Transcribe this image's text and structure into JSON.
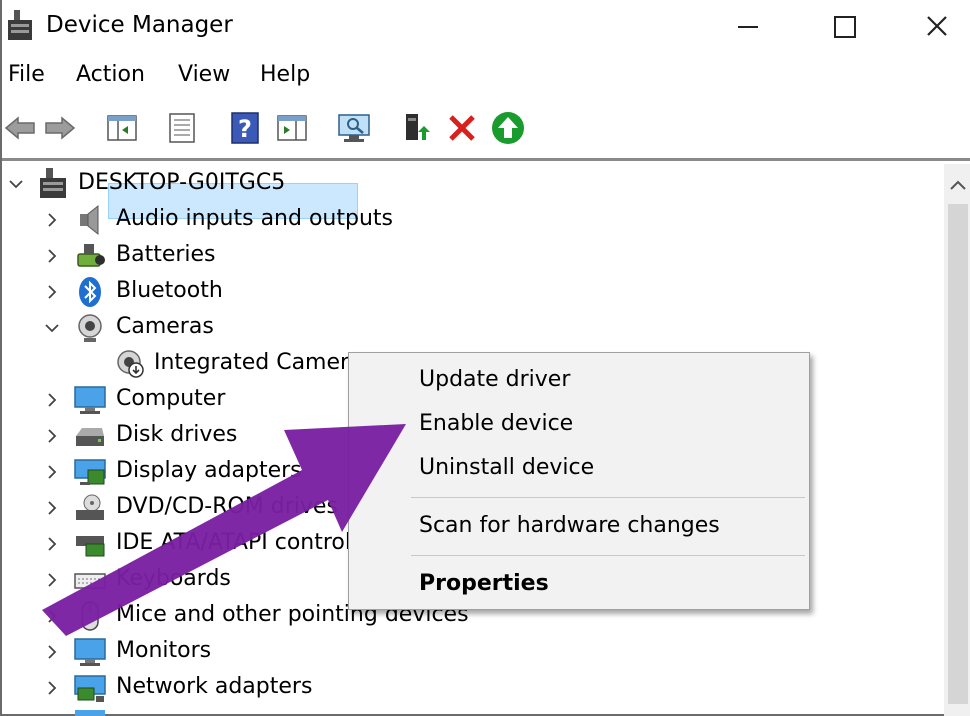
{
  "window": {
    "title": "Device Manager"
  },
  "menu": [
    "File",
    "Action",
    "View",
    "Help"
  ],
  "toolbar": {
    "icons": [
      "back-arrow-icon",
      "forward-arrow-icon",
      "show-hide-console-tree-icon",
      "properties-icon",
      "help-icon",
      "action-pane-icon",
      "scan-hardware-icon",
      "update-driver-icon",
      "uninstall-icon",
      "enable-device-icon"
    ]
  },
  "tree": {
    "root": "DESKTOP-G0ITGC5",
    "categories": [
      {
        "label": "Audio inputs and outputs",
        "icon": "speaker-icon",
        "expanded": false
      },
      {
        "label": "Batteries",
        "icon": "battery-icon",
        "expanded": false
      },
      {
        "label": "Bluetooth",
        "icon": "bluetooth-icon",
        "expanded": false
      },
      {
        "label": "Cameras",
        "icon": "camera-icon",
        "expanded": true
      },
      {
        "label": "Integrated Camera",
        "icon": "camera-disabled-icon",
        "child": true,
        "selected": true
      },
      {
        "label": "Computer",
        "icon": "monitor-icon",
        "expanded": false
      },
      {
        "label": "Disk drives",
        "icon": "disk-drive-icon",
        "expanded": false
      },
      {
        "label": "Display adapters",
        "icon": "display-adapter-icon",
        "expanded": false
      },
      {
        "label": "DVD/CD-ROM drives",
        "icon": "dvd-drive-icon",
        "expanded": false
      },
      {
        "label": "IDE ATA/ATAPI controllers",
        "icon": "ide-controller-icon",
        "expanded": false
      },
      {
        "label": "Keyboards",
        "icon": "keyboard-icon",
        "expanded": false
      },
      {
        "label": "Mice and other pointing devices",
        "icon": "mouse-icon",
        "expanded": false
      },
      {
        "label": "Monitors",
        "icon": "monitor-icon",
        "expanded": false
      },
      {
        "label": "Network adapters",
        "icon": "network-adapter-icon",
        "expanded": false
      }
    ]
  },
  "context_menu": {
    "items": [
      "Update driver",
      "Enable device",
      "Uninstall device",
      "Scan for hardware changes",
      "Properties"
    ]
  },
  "colors": {
    "selection": "#cce8ff",
    "annotation_arrow": "#7a1fa2",
    "enable_green": "#1a9b2e",
    "uninstall_red": "#d8201c"
  }
}
